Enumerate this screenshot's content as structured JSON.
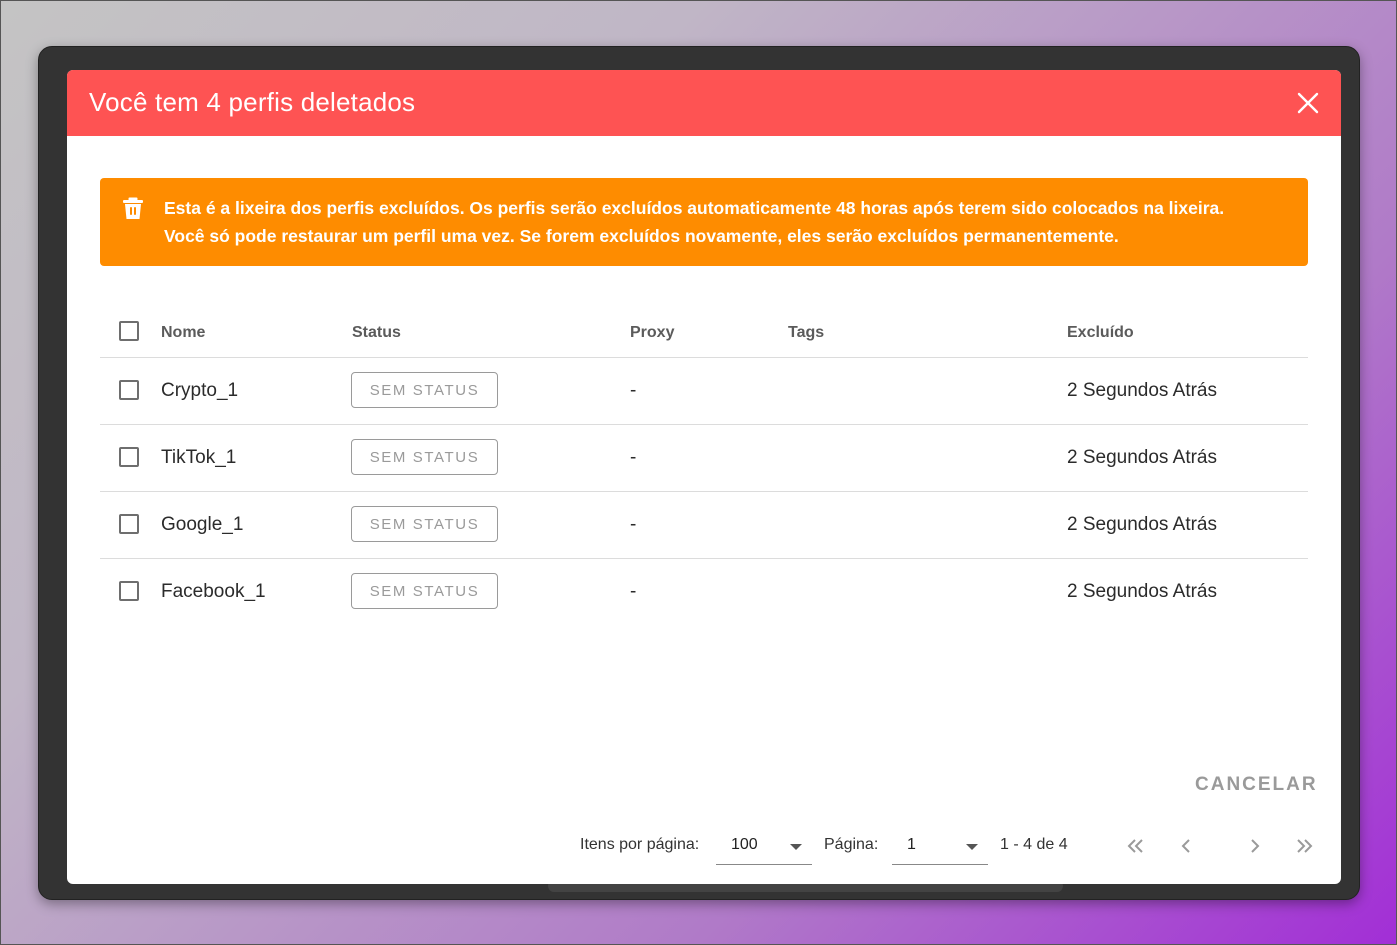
{
  "dialog": {
    "title": "Você tem 4 perfis deletados",
    "header_color": "#fe5353",
    "close_icon": "close-icon"
  },
  "alert": {
    "color": "#fe8c00",
    "icon": "trash-icon",
    "line1": "Esta é a lixeira dos perfis excluídos. Os perfis serão excluídos automaticamente 48 horas após terem sido colocados na lixeira.",
    "line2": "Você só pode restaurar um perfil uma vez. Se forem excluídos novamente, eles serão excluídos permanentemente."
  },
  "table": {
    "headers": {
      "name": "Nome",
      "status": "Status",
      "proxy": "Proxy",
      "tags": "Tags",
      "deleted": "Excluído"
    },
    "rows": [
      {
        "name": "Crypto_1",
        "status": "SEM STATUS",
        "proxy": "-",
        "tags": "",
        "deleted": "2 Segundos Atrás"
      },
      {
        "name": "TikTok_1",
        "status": "SEM STATUS",
        "proxy": "-",
        "tags": "",
        "deleted": "2 Segundos Atrás"
      },
      {
        "name": "Google_1",
        "status": "SEM STATUS",
        "proxy": "-",
        "tags": "",
        "deleted": "2 Segundos Atrás"
      },
      {
        "name": "Facebook_1",
        "status": "SEM STATUS",
        "proxy": "-",
        "tags": "",
        "deleted": "2 Segundos Atrás"
      }
    ]
  },
  "actions": {
    "cancel_label": "CANCELAR"
  },
  "pagination": {
    "items_per_page_label": "Itens por página:",
    "items_per_page_value": "100",
    "page_label": "Página:",
    "page_value": "1",
    "range": "1 - 4 de 4"
  }
}
